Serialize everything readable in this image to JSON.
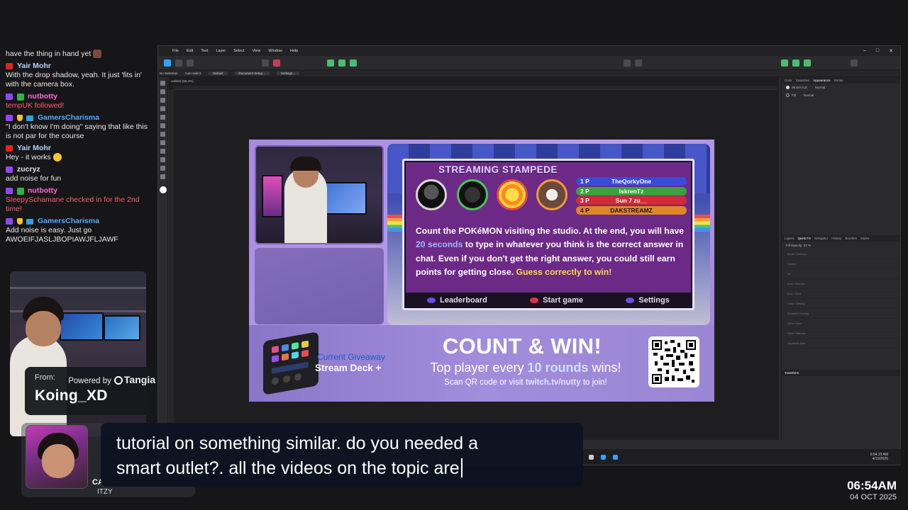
{
  "chat": {
    "messages": [
      {
        "id": "m0",
        "platform": "",
        "user": "",
        "user_color": "",
        "text": "have the thing in hand yet",
        "text_color": "#e8e8ec"
      },
      {
        "id": "m1",
        "platform": "youtube",
        "user": "Yair Mohr",
        "user_color": "#b8d4ff",
        "text": "With the drop shadow, yeah. It just 'fits in' with the camera box.",
        "text_color": "#e8e8ec"
      },
      {
        "id": "m2",
        "platform": "twitch",
        "user": "nutbotty",
        "user_color": "#ff6ad5",
        "text": "tempUK followed!",
        "text_color": "#ff5a6b"
      },
      {
        "id": "m3",
        "platform": "twitch",
        "user": "GamersCharisma",
        "user_color": "#5aa8ff",
        "text": "\"I don't know  I'm doing\" saying that like this is not par for the course",
        "text_color": "#e8e8ec"
      },
      {
        "id": "m4",
        "platform": "youtube",
        "user": "Yair Mohr",
        "user_color": "#b8d4ff",
        "text": "Hey - it works",
        "text_color": "#e8e8ec"
      },
      {
        "id": "m5",
        "platform": "twitch",
        "user": "zucryz",
        "user_color": "#e8e8ec",
        "text": "add noise for fun",
        "text_color": "#e8e8ec"
      },
      {
        "id": "m6",
        "platform": "twitch",
        "user": "nutbotty",
        "user_color": "#ff6ad5",
        "text": "SleepySchamane checked in for the 2nd time!",
        "text_color": "#ff5a6b"
      },
      {
        "id": "m7",
        "platform": "twitch",
        "user": "GamersCharisma",
        "user_color": "#5aa8ff",
        "text": "Add noise is easy. Just go AWOEIFJASLJBOPIAWJFLJAWF",
        "text_color": "#e8e8ec"
      }
    ]
  },
  "alert": {
    "from_label": "From:",
    "powered_by": "Powered by",
    "brand": "Tangia",
    "username": "Koing_XD"
  },
  "avatar": {
    "name": "CA",
    "sub": "ITZY"
  },
  "app": {
    "menu": [
      "File",
      "Edit",
      "Text",
      "Layer",
      "Select",
      "View",
      "Window",
      "Help"
    ],
    "context": {
      "selection": "No Selection",
      "autoselect": "Auto-select:",
      "mode": "Default",
      "doc_setup": "Document Setup...",
      "settings": "Settings..."
    },
    "doc_tab": "untitled (55.4%)",
    "panel_tabs": [
      "Color",
      "Swatches",
      "Appearance",
      "Stroke"
    ],
    "appearance_rows": [
      "Stroke 0 pt",
      "Normal",
      "Fill",
      "Normal"
    ],
    "layer_tabs": [
      "Layers",
      "Quick FX",
      "Navigator",
      "History",
      "Brushes",
      "Styles"
    ],
    "fx_opacity": "Fill Opacity: 22 %",
    "effects": [
      "Bevel / Emboss",
      "Outline",
      "3D",
      "Inner Shadow",
      "Inner Glow",
      "Color Overlay",
      "Gradient Overlay",
      "Outer Glow",
      "Outer Shadow",
      "Gaussian Blur"
    ],
    "transform_title": "Transform",
    "tray_time": "6:54:19 AM",
    "tray_date": "4/10/2025"
  },
  "overlay": {
    "game_title": "STREAMING STAMPEDE",
    "leaderboard": [
      {
        "rank": "1 P",
        "name": "TheQorkyOne",
        "color": "#3d4ad8"
      },
      {
        "rank": "2 P",
        "name": "IskrenTz",
        "color": "#38a340"
      },
      {
        "rank": "3 P",
        "name": "Sun 7 zu__",
        "color": "#d32a37"
      },
      {
        "rank": "4 P",
        "name": "DAKSTREAMZ",
        "color": "#e0852a"
      }
    ],
    "text_1": "Count the POKéMON visiting the studio. At the end, you will have ",
    "text_highlight": "20 seconds",
    "text_2": " to type in whatever you think is the correct answer in chat. Even if you don't get the right answer, you could still earn points for getting close. ",
    "text_yellow": "Guess correctly to win!",
    "footer": [
      "Leaderboard",
      "Start game",
      "Settings"
    ],
    "giveaway_label": "Current Giveaway",
    "giveaway_item": "Stream Deck +",
    "count_title": "COUNT & WIN!",
    "count_sub_1": "Top player every ",
    "count_sub_hl": "10 rounds",
    "count_sub_2": " wins!",
    "scan_1": "Scan QR code or visit ",
    "scan_link": "twitch.tv/nutty",
    "scan_2": " to join!"
  },
  "caption": {
    "line1": "tutorial on something similar. do you needed a",
    "line2": "smart outlet?. all the videos on the topic are"
  },
  "clock": {
    "time": "06:54AM",
    "date": "04 OCT 2025"
  }
}
